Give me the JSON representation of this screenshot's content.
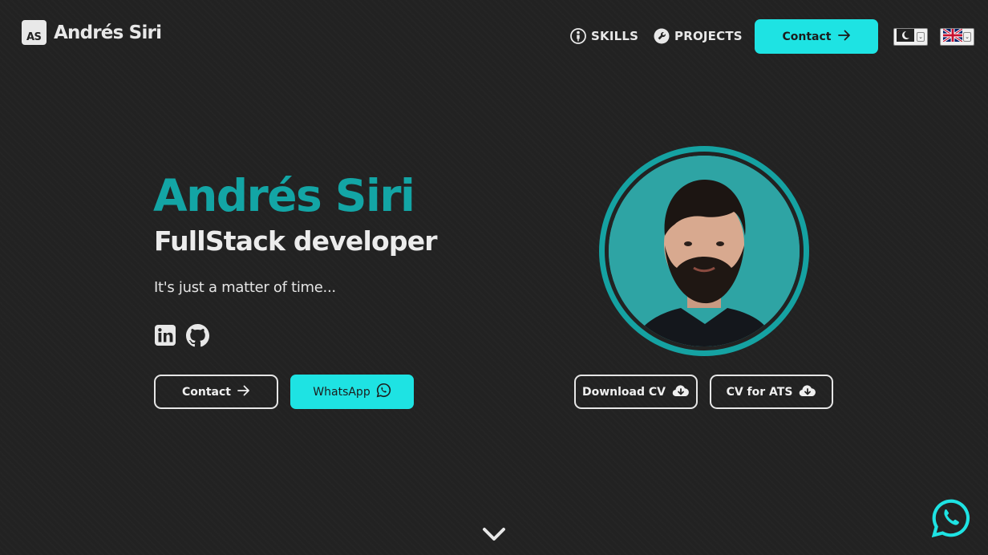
{
  "header": {
    "logo_mark": "AS",
    "logo_text": "Andrés Siri",
    "nav": [
      {
        "label": "SKILLS",
        "icon": "person-icon"
      },
      {
        "label": "PROJECTS",
        "icon": "wrench-icon"
      }
    ],
    "contact_label": "Contact",
    "theme_selector_icon": "moon-icon",
    "language_selector_icon": "uk-flag-icon"
  },
  "hero": {
    "name": "Andrés Siri",
    "role": "FullStack developer",
    "tagline": "It's just a matter of time...",
    "social": [
      {
        "icon": "linkedin-icon"
      },
      {
        "icon": "github-icon"
      }
    ],
    "contact_label": "Contact",
    "whatsapp_label": "WhatsApp",
    "download_cv_label": "Download CV",
    "cv_ats_label": "CV for ATS"
  },
  "colors": {
    "accent": "#1ee3e3",
    "brand_teal": "#13a5a5",
    "background": "#222222"
  }
}
